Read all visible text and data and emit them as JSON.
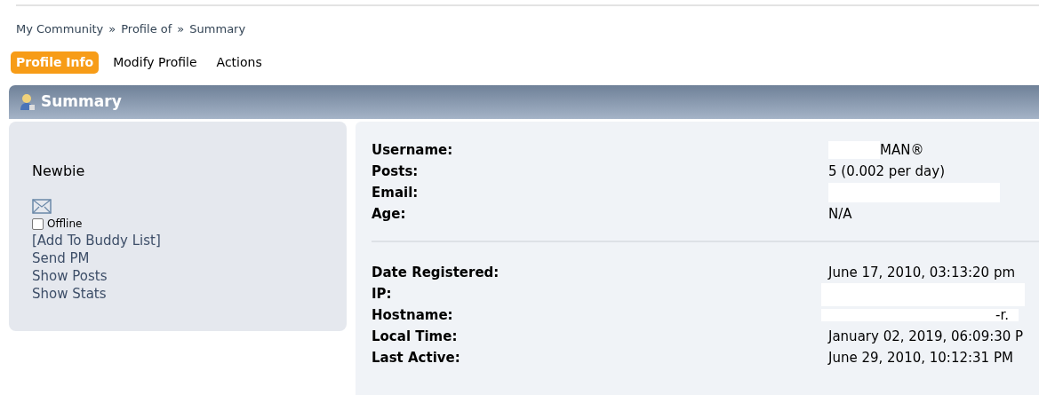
{
  "breadcrumb": [
    "My Community",
    "Profile of",
    "Summary"
  ],
  "breadcrumb_separator": "»",
  "tabs": [
    {
      "label": "Profile Info",
      "selected": true
    },
    {
      "label": "Modify Profile",
      "selected": false
    },
    {
      "label": "Actions",
      "selected": false
    }
  ],
  "section_title": "Summary",
  "sidebar": {
    "rank": "Newbie",
    "status": {
      "label": "Offline",
      "checked": false
    },
    "links": [
      "[Add To Buddy List]",
      "Send PM",
      "Show Posts",
      "Show Stats"
    ]
  },
  "details": [
    {
      "label": "Username:",
      "value": "MAN®",
      "redacted": true
    },
    {
      "label": "Posts:",
      "value": "5 (0.002 per day)",
      "redacted": false
    },
    {
      "label": "Email:",
      "redacted": true
    },
    {
      "label": "Age:",
      "value": "N/A",
      "redacted": false
    }
  ],
  "details_more": [
    {
      "label": "Date Registered:",
      "value": "June 17, 2010, 03:13:20 pm",
      "redacted": false
    },
    {
      "label": "IP:",
      "redacted": true
    },
    {
      "label": "Hostname:",
      "value": "-r.",
      "redacted": true
    },
    {
      "label": "Local Time:",
      "value": "January 02, 2019, 06:09:30 P",
      "redacted": false
    },
    {
      "label": "Last Active:",
      "value": "June 29, 2010, 10:12:31 PM",
      "redacted": false
    }
  ]
}
